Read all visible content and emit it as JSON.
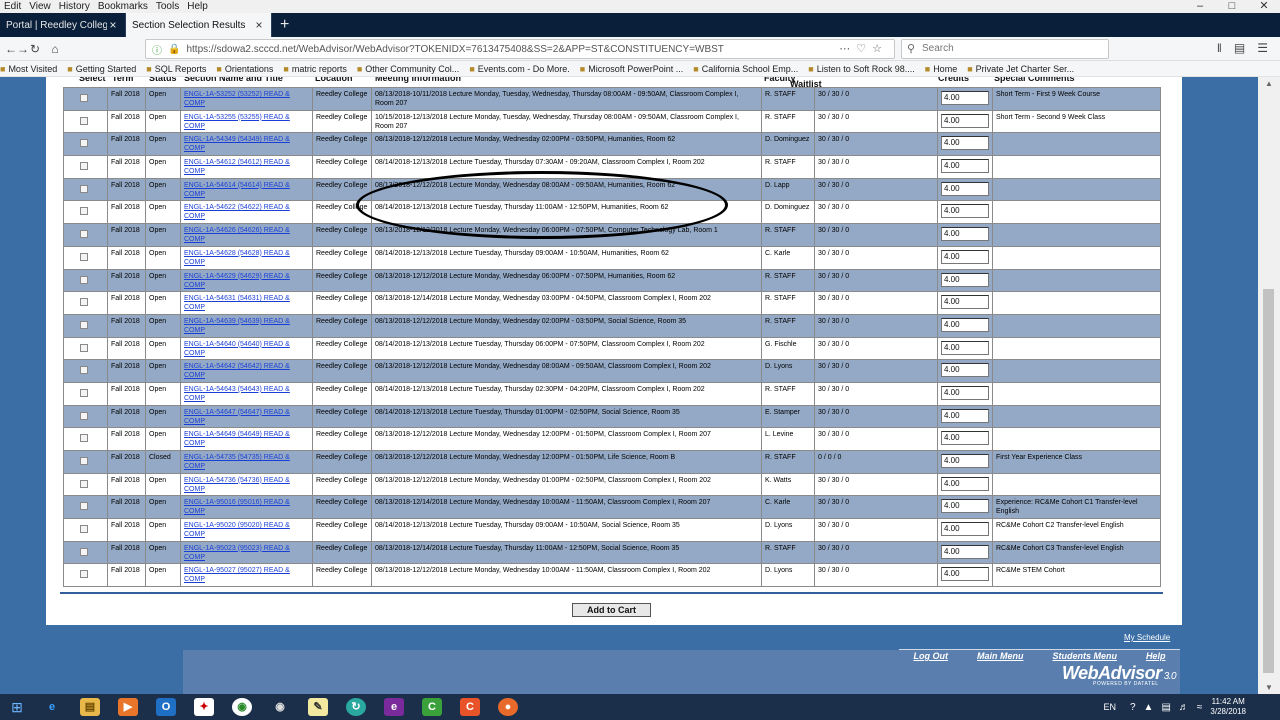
{
  "menu": [
    "Edit",
    "View",
    "History",
    "Bookmarks",
    "Tools",
    "Help"
  ],
  "tabs": [
    {
      "title": "Portal | Reedley College",
      "active": false
    },
    {
      "title": "Section Selection Results",
      "active": true
    }
  ],
  "address": {
    "url": "https://sdowa2.scccd.net/WebAdvisor/WebAdvisor?TOKENIDX=7613475408&SS=2&APP=ST&CONSTITUENCY=WBST"
  },
  "search": {
    "placeholder": "Search"
  },
  "bookmarks": [
    "Most Visited",
    "Getting Started",
    "SQL Reports",
    "Orientations",
    "matric reports",
    "Other Community Col...",
    "Events.com - Do More.",
    "Microsoft PowerPoint ...",
    "California School Emp...",
    "Listen to Soft Rock 98....",
    "Home",
    "Private Jet Charter Ser..."
  ],
  "table": {
    "headers": [
      "Select",
      "Term",
      "Status",
      "Section Name and Title",
      "Location",
      "Meeting Information",
      "Faculty",
      "Waitlist",
      "Credits",
      "Special Comments"
    ],
    "rows": [
      {
        "term": "Fall 2018",
        "status": "Open",
        "section": "ENGL-1A-53252 (53252) READ & COMP",
        "location": "Reedley College",
        "meeting": "08/13/2018-10/11/2018 Lecture Monday, Tuesday, Wednesday, Thursday 08:00AM - 09:50AM, Classroom Complex I, Room 207",
        "faculty": "R. STAFF",
        "waitlist": "30 / 30 / 0",
        "credits": "4.00",
        "comments": "Short Term - First 9 Week Course"
      },
      {
        "term": "Fall 2018",
        "status": "Open",
        "section": "ENGL-1A-53255 (53255) READ & COMP",
        "location": "Reedley College",
        "meeting": "10/15/2018-12/13/2018 Lecture Monday, Tuesday, Wednesday, Thursday 08:00AM - 09:50AM, Classroom Complex I, Room 207",
        "faculty": "R. STAFF",
        "waitlist": "30 / 30 / 0",
        "credits": "4.00",
        "comments": "Short Term - Second 9 Week Class"
      },
      {
        "term": "Fall 2018",
        "status": "Open",
        "section": "ENGL-1A-54349 (54349) READ & COMP",
        "location": "Reedley College",
        "meeting": "08/13/2018-12/12/2018 Lecture Monday, Wednesday 02:00PM - 03:50PM, Humanities, Room 62",
        "faculty": "D. Dominguez",
        "waitlist": "30 / 30 / 0",
        "credits": "4.00",
        "comments": ""
      },
      {
        "term": "Fall 2018",
        "status": "Open",
        "section": "ENGL-1A-54612 (54612) READ & COMP",
        "location": "Reedley College",
        "meeting": "08/14/2018-12/13/2018 Lecture Tuesday, Thursday 07:30AM - 09:20AM, Classroom Complex I, Room 202",
        "faculty": "R. STAFF",
        "waitlist": "30 / 30 / 0",
        "credits": "4.00",
        "comments": ""
      },
      {
        "term": "Fall 2018",
        "status": "Open",
        "section": "ENGL-1A-54614 (54614) READ & COMP",
        "location": "Reedley College",
        "meeting": "08/13/2018-12/12/2018 Lecture Monday, Wednesday 08:00AM - 09:50AM, Humanities, Room 62",
        "faculty": "D. Lapp",
        "waitlist": "30 / 30 / 0",
        "credits": "4.00",
        "comments": ""
      },
      {
        "term": "Fall 2018",
        "status": "Open",
        "section": "ENGL-1A-54622 (54622) READ & COMP",
        "location": "Reedley College",
        "meeting": "08/14/2018-12/13/2018 Lecture Tuesday, Thursday 11:00AM - 12:50PM, Humanities, Room 62",
        "faculty": "D. Dominguez",
        "waitlist": "30 / 30 / 0",
        "credits": "4.00",
        "comments": ""
      },
      {
        "term": "Fall 2018",
        "status": "Open",
        "section": "ENGL-1A-54626 (54626) READ & COMP",
        "location": "Reedley College",
        "meeting": "08/13/2018-12/12/2018 Lecture Monday, Wednesday 06:00PM - 07:50PM, Computer Technology Lab, Room 1",
        "faculty": "R. STAFF",
        "waitlist": "30 / 30 / 0",
        "credits": "4.00",
        "comments": ""
      },
      {
        "term": "Fall 2018",
        "status": "Open",
        "section": "ENGL-1A-54628 (54628) READ & COMP",
        "location": "Reedley College",
        "meeting": "08/14/2018-12/13/2018 Lecture Tuesday, Thursday 09:00AM - 10:50AM, Humanities, Room 62",
        "faculty": "C. Karle",
        "waitlist": "30 / 30 / 0",
        "credits": "4.00",
        "comments": ""
      },
      {
        "term": "Fall 2018",
        "status": "Open",
        "section": "ENGL-1A-54629 (54629) READ & COMP",
        "location": "Reedley College",
        "meeting": "08/13/2018-12/12/2018 Lecture Monday, Wednesday 06:00PM - 07:50PM, Humanities, Room 62",
        "faculty": "R. STAFF",
        "waitlist": "30 / 30 / 0",
        "credits": "4.00",
        "comments": ""
      },
      {
        "term": "Fall 2018",
        "status": "Open",
        "section": "ENGL-1A-54631 (54631) READ & COMP",
        "location": "Reedley College",
        "meeting": "08/13/2018-12/14/2018 Lecture Monday, Wednesday 03:00PM - 04:50PM, Classroom Complex I, Room 202",
        "faculty": "R. STAFF",
        "waitlist": "30 / 30 / 0",
        "credits": "4.00",
        "comments": ""
      },
      {
        "term": "Fall 2018",
        "status": "Open",
        "section": "ENGL-1A-54639 (54639) READ & COMP",
        "location": "Reedley College",
        "meeting": "08/13/2018-12/12/2018 Lecture Monday, Wednesday 02:00PM - 03:50PM, Social Science, Room 35",
        "faculty": "R. STAFF",
        "waitlist": "30 / 30 / 0",
        "credits": "4.00",
        "comments": ""
      },
      {
        "term": "Fall 2018",
        "status": "Open",
        "section": "ENGL-1A-54640 (54640) READ & COMP",
        "location": "Reedley College",
        "meeting": "08/14/2018-12/13/2018 Lecture Tuesday, Thursday 06:00PM - 07:50PM, Classroom Complex I, Room 202",
        "faculty": "G. Fischle",
        "waitlist": "30 / 30 / 0",
        "credits": "4.00",
        "comments": ""
      },
      {
        "term": "Fall 2018",
        "status": "Open",
        "section": "ENGL-1A-54642 (54642) READ & COMP",
        "location": "Reedley College",
        "meeting": "08/13/2018-12/12/2018 Lecture Monday, Wednesday 08:00AM - 09:50AM, Classroom Complex I, Room 202",
        "faculty": "D. Lyons",
        "waitlist": "30 / 30 / 0",
        "credits": "4.00",
        "comments": ""
      },
      {
        "term": "Fall 2018",
        "status": "Open",
        "section": "ENGL-1A-54643 (54643) READ & COMP",
        "location": "Reedley College",
        "meeting": "08/14/2018-12/13/2018 Lecture Tuesday, Thursday 02:30PM - 04:20PM, Classroom Complex I, Room 202",
        "faculty": "R. STAFF",
        "waitlist": "30 / 30 / 0",
        "credits": "4.00",
        "comments": ""
      },
      {
        "term": "Fall 2018",
        "status": "Open",
        "section": "ENGL-1A-54647 (54647) READ & COMP",
        "location": "Reedley College",
        "meeting": "08/14/2018-12/13/2018 Lecture Tuesday, Thursday 01:00PM - 02:50PM, Social Science, Room 35",
        "faculty": "E. Stamper",
        "waitlist": "30 / 30 / 0",
        "credits": "4.00",
        "comments": ""
      },
      {
        "term": "Fall 2018",
        "status": "Open",
        "section": "ENGL-1A-54649 (54649) READ & COMP",
        "location": "Reedley College",
        "meeting": "08/13/2018-12/12/2018 Lecture Monday, Wednesday 12:00PM - 01:50PM, Classroom Complex I, Room 207",
        "faculty": "L. Levine",
        "waitlist": "30 / 30 / 0",
        "credits": "4.00",
        "comments": ""
      },
      {
        "term": "Fall 2018",
        "status": "Closed",
        "section": "ENGL-1A-54735 (54735) READ & COMP",
        "location": "Reedley College",
        "meeting": "08/13/2018-12/12/2018 Lecture Monday, Wednesday 12:00PM - 01:50PM, Life Science, Room B",
        "faculty": "R. STAFF",
        "waitlist": "0 / 0 / 0",
        "credits": "4.00",
        "comments": "First Year Experience Class"
      },
      {
        "term": "Fall 2018",
        "status": "Open",
        "section": "ENGL-1A-54736 (54736) READ & COMP",
        "location": "Reedley College",
        "meeting": "08/13/2018-12/12/2018 Lecture Monday, Wednesday 01:00PM - 02:50PM, Classroom Complex I, Room 202",
        "faculty": "K. Watts",
        "waitlist": "30 / 30 / 0",
        "credits": "4.00",
        "comments": ""
      },
      {
        "term": "Fall 2018",
        "status": "Open",
        "section": "ENGL-1A-95016 (95016) READ & COMP",
        "location": "Reedley College",
        "meeting": "08/13/2018-12/14/2018 Lecture Monday, Wednesday 10:00AM - 11:50AM, Classroom Complex I, Room 207",
        "faculty": "C. Karle",
        "waitlist": "30 / 30 / 0",
        "credits": "4.00",
        "comments": "Experience: RC&Me Cohort C1 Transfer-level English"
      },
      {
        "term": "Fall 2018",
        "status": "Open",
        "section": "ENGL-1A-95020 (95020) READ & COMP",
        "location": "Reedley College",
        "meeting": "08/14/2018-12/13/2018 Lecture Tuesday, Thursday 09:00AM - 10:50AM, Social Science, Room 35",
        "faculty": "D. Lyons",
        "waitlist": "30 / 30 / 0",
        "credits": "4.00",
        "comments": "RC&Me Cohort C2 Transfer-level English"
      },
      {
        "term": "Fall 2018",
        "status": "Open",
        "section": "ENGL-1A-95023 (95023) READ & COMP",
        "location": "Reedley College",
        "meeting": "08/13/2018-12/14/2018 Lecture Tuesday, Thursday 11:00AM - 12:50PM, Social Science, Room 35",
        "faculty": "R. STAFF",
        "waitlist": "30 / 30 / 0",
        "credits": "4.00",
        "comments": "RC&Me Cohort C3 Transfer-level English"
      },
      {
        "term": "Fall 2018",
        "status": "Open",
        "section": "ENGL-1A-95027 (95027) READ & COMP",
        "location": "Reedley College",
        "meeting": "08/13/2018-12/12/2018 Lecture Monday, Wednesday 10:00AM - 11:50AM, Classroom Complex I, Room 202",
        "faculty": "D. Lyons",
        "waitlist": "30 / 30 / 0",
        "credits": "4.00",
        "comments": "RC&Me STEM Cohort"
      }
    ]
  },
  "actions": {
    "add_to_cart": "Add to Cart",
    "my_schedule": "My Schedule"
  },
  "footer": {
    "links": [
      "Log Out",
      "Main Menu",
      "Students Menu",
      "Help"
    ],
    "logo": "WebAdvisor",
    "logo_version": "3.0",
    "logo_sub": "POWERED BY DATATEL"
  },
  "taskbar": {
    "language": "EN",
    "time": "11:42 AM",
    "date": "3/28/2018"
  },
  "colors": {
    "table_alt_row": "#94a9c5",
    "page_background": "#3a6ea5",
    "link": "#1a3fd6"
  }
}
